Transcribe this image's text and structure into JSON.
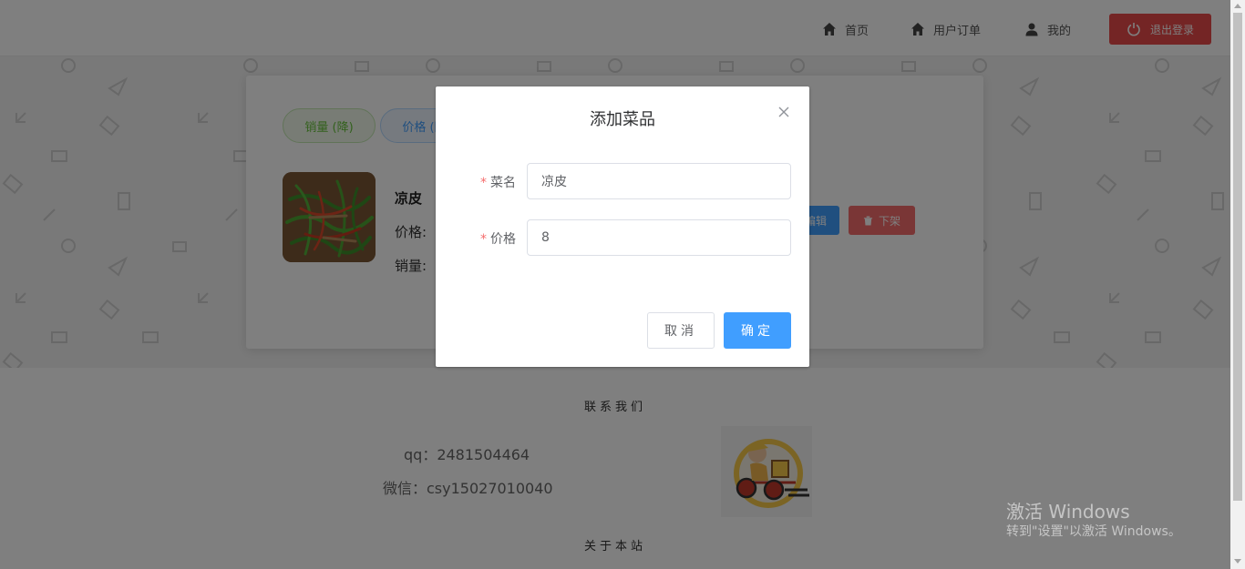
{
  "header": {
    "nav": [
      {
        "label": "首页",
        "icon": "home-icon"
      },
      {
        "label": "用户订单",
        "icon": "home-icon"
      },
      {
        "label": "我的",
        "icon": "user-icon"
      }
    ],
    "logout_label": "退出登录",
    "logout_color": "#e84a4a"
  },
  "card": {
    "sort_tags": [
      {
        "label": "销量 (降)"
      },
      {
        "label": "价格 (降)"
      }
    ],
    "dish": {
      "name": "凉皮",
      "price_label": "价格:",
      "sales_label": "销量:"
    },
    "edit_label": "编辑",
    "off_label": "下架"
  },
  "footer": {
    "contact_title": "联系我们",
    "qq": "qq：2481504464",
    "wechat": "微信：csy15027010040",
    "about_title": "关于本站"
  },
  "dialog": {
    "title": "添加菜品",
    "fields": [
      {
        "label": "菜名",
        "value": "凉皮",
        "required": true
      },
      {
        "label": "价格",
        "value": "8",
        "required": true
      }
    ],
    "cancel_label": "取消",
    "ok_label": "确定",
    "primary_color": "#409eff"
  },
  "watermark": {
    "line1": "激活 Windows",
    "line2": "转到\"设置\"以激活 Windows。"
  }
}
